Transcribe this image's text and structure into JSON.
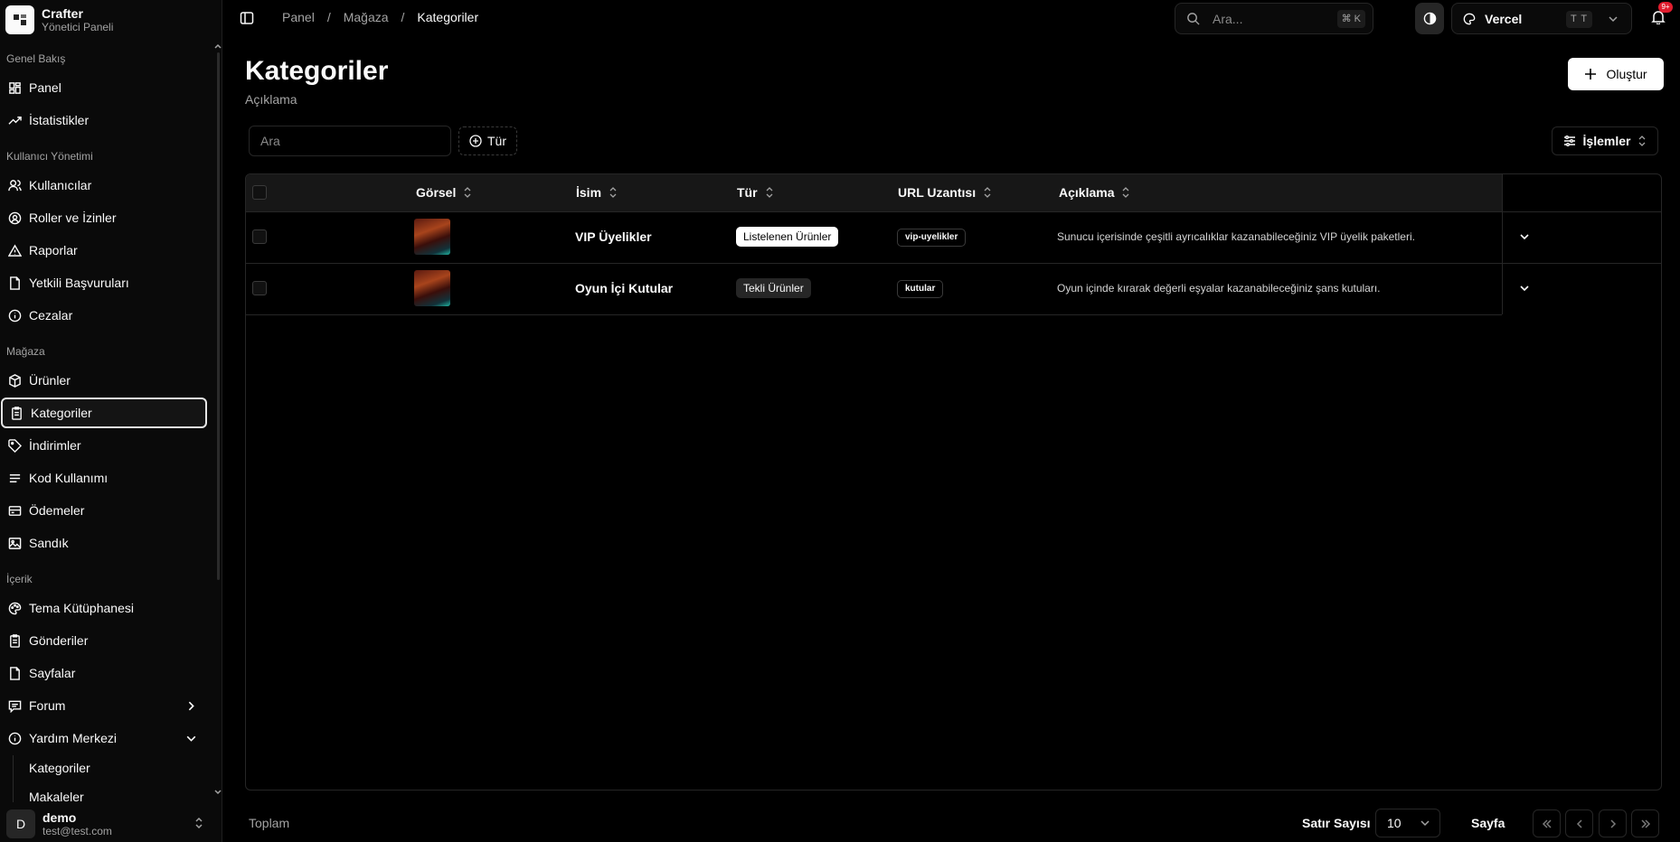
{
  "brand": {
    "name": "Crafter",
    "subtitle": "Yönetici Paneli"
  },
  "sidebar": {
    "groups": [
      {
        "label": "Genel Bakış"
      },
      {
        "label": "Kullanıcı Yönetimi"
      },
      {
        "label": "Mağaza"
      },
      {
        "label": "İçerik"
      }
    ],
    "items": [
      {
        "label": "Panel",
        "icon": "dashboard-icon"
      },
      {
        "label": "İstatistikler",
        "icon": "trending-icon"
      },
      {
        "label": "Kullanıcılar",
        "icon": "users-icon"
      },
      {
        "label": "Roller ve İzinler",
        "icon": "user-circle-icon"
      },
      {
        "label": "Raporlar",
        "icon": "warning-icon"
      },
      {
        "label": "Yetkili Başvuruları",
        "icon": "file-icon"
      },
      {
        "label": "Cezalar",
        "icon": "info-icon"
      },
      {
        "label": "Ürünler",
        "icon": "package-icon"
      },
      {
        "label": "Kategoriler",
        "icon": "clipboard-icon",
        "active": true
      },
      {
        "label": "İndirimler",
        "icon": "tag-icon"
      },
      {
        "label": "Kod Kullanımı",
        "icon": "code-icon"
      },
      {
        "label": "Ödemeler",
        "icon": "wallet-icon"
      },
      {
        "label": "Sandık",
        "icon": "image-icon"
      },
      {
        "label": "Tema Kütüphanesi",
        "icon": "palette-icon"
      },
      {
        "label": "Gönderiler",
        "icon": "clipboard-icon"
      },
      {
        "label": "Sayfalar",
        "icon": "file-icon"
      },
      {
        "label": "Forum",
        "icon": "message-icon"
      },
      {
        "label": "Yardım Merkezi",
        "icon": "info-icon"
      }
    ],
    "subitems": [
      {
        "label": "Kategoriler"
      },
      {
        "label": "Makaleler"
      }
    ],
    "user": {
      "initial": "D",
      "name": "demo",
      "email": "test@test.com"
    }
  },
  "topbar": {
    "breadcrumb": [
      "Panel",
      "Mağaza",
      "Kategoriler"
    ],
    "separator": "/",
    "search_placeholder": "Ara...",
    "search_shortcut": "⌘ K",
    "team_name": "Vercel",
    "team_shortcut": "T T",
    "notifications_badge": "9+"
  },
  "page": {
    "title": "Kategoriler",
    "description": "Açıklama",
    "create_label": "Oluştur",
    "filter_placeholder": "Ara",
    "type_filter_label": "Tür",
    "actions_label": "İşlemler"
  },
  "table": {
    "columns": [
      "Görsel",
      "İsim",
      "Tür",
      "URL Uzantısı",
      "Açıklama"
    ],
    "rows": [
      {
        "name": "VIP Üyelikler",
        "type": "Listelenen Ürünler",
        "type_style": "white",
        "slug": "vip-uyelikler",
        "description": "Sunucu içerisinde çeşitli ayrıcalıklar kazanabileceğiniz VIP üyelik paketleri."
      },
      {
        "name": "Oyun İçi Kutular",
        "type": "Tekli Ürünler",
        "type_style": "dark",
        "slug": "kutular",
        "description": "Oyun içinde kırarak değerli eşyalar kazanabileceğiniz şans kutuları."
      }
    ]
  },
  "footer": {
    "total_label": "Toplam",
    "rows_label": "Satır Sayısı",
    "rows_value": "10",
    "page_label": "Sayfa"
  },
  "colors": {
    "background": "#000000",
    "sidebar": "#0a0a0a",
    "border": "#262626",
    "badge": "#e11d2e"
  }
}
